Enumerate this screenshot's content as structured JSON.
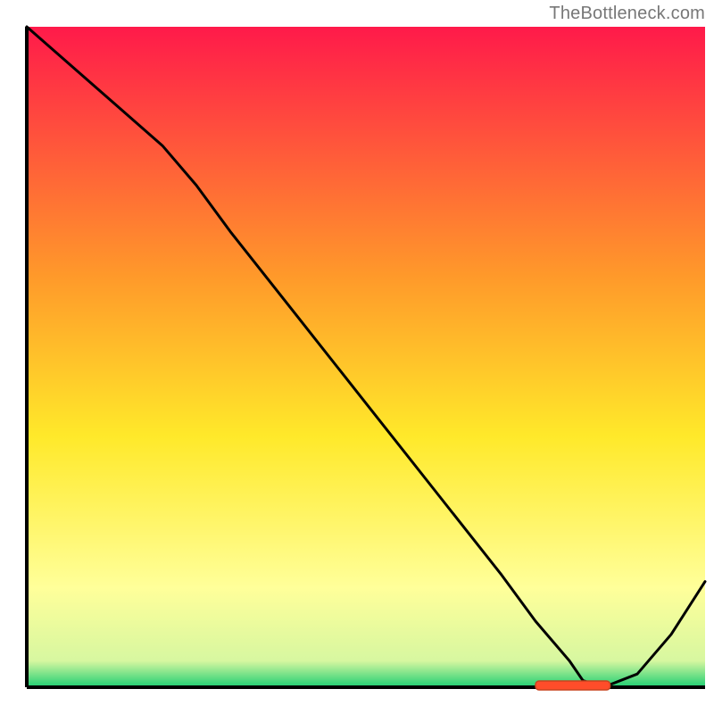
{
  "watermark": "TheBottleneck.com",
  "colors": {
    "gradient_top": "#ff1a4a",
    "gradient_mid1": "#ff9a2a",
    "gradient_mid2": "#ffe92a",
    "gradient_mid3": "#ffff9a",
    "gradient_bottom": "#1ece73",
    "axis": "#000000",
    "line": "#000000",
    "marker_fill": "#ff4d2a",
    "marker_stroke": "#c8441f"
  },
  "chart_data": {
    "type": "line",
    "title": "",
    "xlabel": "",
    "ylabel": "",
    "xlim": [
      0,
      100
    ],
    "ylim": [
      0,
      100
    ],
    "x": [
      0,
      10,
      20,
      25,
      30,
      40,
      50,
      60,
      70,
      75,
      80,
      82,
      85,
      90,
      95,
      100
    ],
    "values": [
      100,
      91,
      82,
      76,
      69,
      56,
      43,
      30,
      17,
      10,
      4,
      1,
      0,
      2,
      8,
      16
    ],
    "marker": {
      "x_start": 75,
      "x_end": 86,
      "y": 0
    },
    "grid": false,
    "legend": false
  }
}
